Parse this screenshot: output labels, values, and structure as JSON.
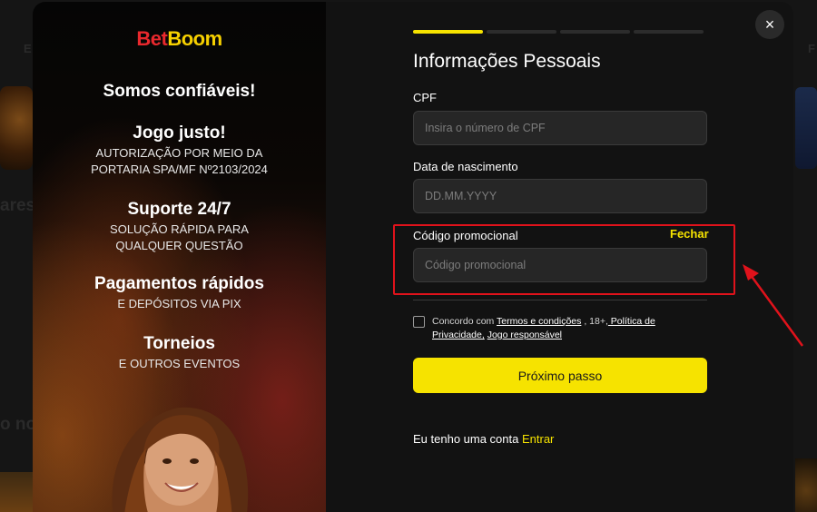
{
  "background": {
    "left_nav_fragment": "E",
    "left_heading_fragment": "ares",
    "left_bottom_fragment": "o no",
    "right_nav_fragment": "F"
  },
  "brand": {
    "bet": "Bet",
    "boom": "Boom"
  },
  "promo": [
    {
      "title": "Somos confiáveis!",
      "subtitle": ""
    },
    {
      "title": "Jogo justo!",
      "subtitle": "AUTORIZAÇÃO POR MEIO DA PORTARIA SPA/MF Nº2103/2024"
    },
    {
      "title": "Suporte 24/7",
      "subtitle": "SOLUÇÃO RÁPIDA PARA QUALQUER QUESTÃO"
    },
    {
      "title": "Pagamentos rápidos",
      "subtitle": "E DEPÓSITOS VIA PIX"
    },
    {
      "title": "Torneios",
      "subtitle": "E OUTROS EVENTOS"
    }
  ],
  "progress": {
    "total_steps": 4,
    "current_step": 1
  },
  "close": {
    "symbol": "×"
  },
  "form": {
    "title": "Informações Pessoais",
    "cpf": {
      "label": "CPF",
      "placeholder": "Insira o número de CPF",
      "value": ""
    },
    "birth": {
      "label": "Data de nascimento",
      "placeholder": "DD.MM.YYYY",
      "value": ""
    },
    "promo": {
      "label": "Código promocional",
      "placeholder": "Código promocional",
      "value": "",
      "close_label": "Fechar"
    },
    "terms": {
      "prefix": "Concordo com ",
      "terms_link": "Termos e condições",
      "middle": " , 18+,",
      "privacy_link": " Política de Privacidade,",
      "responsible_link": "Jogo responsável",
      "checked": false
    },
    "next_button": "Próximo passo",
    "login_prefix": "Eu tenho uma conta ",
    "login_link": "Entrar"
  },
  "colors": {
    "accent_yellow": "#f6e300",
    "brand_red": "#e8282d",
    "highlight_red": "#e0121b",
    "modal_bg": "#121212"
  }
}
